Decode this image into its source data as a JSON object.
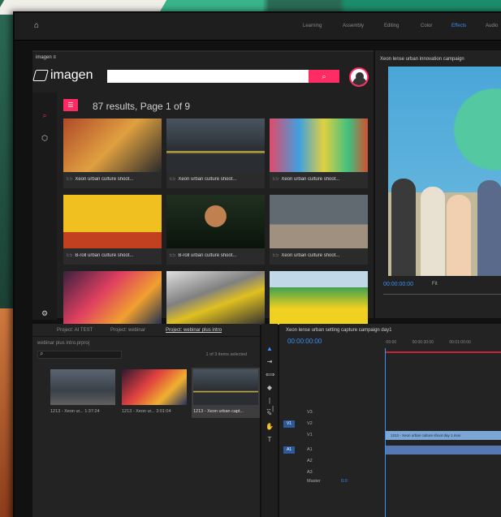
{
  "workspaces": [
    "Learning",
    "Assembly",
    "Editing",
    "Color",
    "Effects",
    "Audio"
  ],
  "active_workspace": "Effects",
  "imagen": {
    "panel_tab": "imagen",
    "logo_text": "imagen",
    "search_placeholder": "",
    "results_text": "87 results, Page 1 of 9",
    "cards": [
      {
        "badge": "E5",
        "caption": "Xeon urban culture shoot..."
      },
      {
        "badge": "E5",
        "caption": "Xeon urban culture shoot..."
      },
      {
        "badge": "E5",
        "caption": "Xeon urban culture shoot..."
      },
      {
        "badge": "E5",
        "caption": "B-roll urban culture shoot..."
      },
      {
        "badge": "E5",
        "caption": "B-roll urban culture shoot..."
      },
      {
        "badge": "E5",
        "caption": "Xeon urban culture shoot..."
      },
      {
        "badge": "",
        "caption": ""
      },
      {
        "badge": "",
        "caption": ""
      },
      {
        "badge": "",
        "caption": ""
      }
    ]
  },
  "program": {
    "title": "Xeon lense urban innovation campaign",
    "timecode": "00:00:00:00",
    "fit": "Fit"
  },
  "project": {
    "tabs": [
      "Project: AI TEST",
      "Project: webinar",
      "Project: webinar plus intro"
    ],
    "active_tab": "Project: webinar plus intro",
    "file": "webinar plus intro.prproj",
    "count": "1 of 3 items selected",
    "clips": [
      {
        "label": "1213 - Xeon ur...  1:37:24"
      },
      {
        "label": "1213 - Xeon ur...  3:01:04"
      },
      {
        "label": "1213 - Xeon urban capt..."
      }
    ]
  },
  "timeline": {
    "title": "Xeon lense urban setting capture campaign day1",
    "timecode": "00:00:00:00",
    "ruler": [
      "-00:00",
      "00:00:30:00",
      "00:01:00:00"
    ],
    "tracks": [
      {
        "name": "V3",
        "btn": ""
      },
      {
        "name": "V2",
        "btn": "V1"
      },
      {
        "name": "V1",
        "btn": ""
      },
      {
        "name": "A1",
        "btn": "A1"
      },
      {
        "name": "A2",
        "btn": ""
      },
      {
        "name": "A3",
        "btn": ""
      }
    ],
    "video_clip": "1213 - Xeon urban culture shoot day 1.mov",
    "master": "Master",
    "master_val": "0.0"
  },
  "colors": {
    "accent": "#ff2c64",
    "blue": "#3b8ff3"
  }
}
